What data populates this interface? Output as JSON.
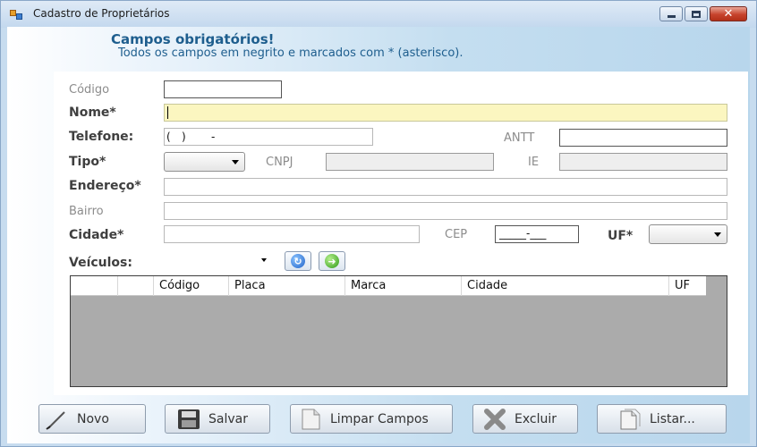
{
  "window": {
    "title": "Cadastro de Proprietários",
    "close_glyph": "✕"
  },
  "header": {
    "title": "Campos obrigatórios!",
    "subtitle": "Todos os campos em negrito e marcados com * (asterisco)."
  },
  "form": {
    "codigo": {
      "label": "Código",
      "value": ""
    },
    "nome": {
      "label": "Nome*",
      "value": ""
    },
    "telefone": {
      "label": "Telefone:",
      "mask_open": "(",
      "mask_close": ")",
      "mask_dash": "-"
    },
    "antt": {
      "label": "ANTT",
      "value": ""
    },
    "tipo": {
      "label": "Tipo*",
      "selected": ""
    },
    "cnpj": {
      "label": "CNPJ",
      "value": ""
    },
    "ie": {
      "label": "IE",
      "value": ""
    },
    "endereco": {
      "label": "Endereço*",
      "value": ""
    },
    "bairro": {
      "label": "Bairro",
      "value": ""
    },
    "cidade": {
      "label": "Cidade*",
      "value": ""
    },
    "cep": {
      "label": "CEP",
      "mask": "_____-___"
    },
    "uf": {
      "label": "UF*",
      "selected": ""
    },
    "veiculos": {
      "label": "Veículos:"
    }
  },
  "grid": {
    "columns": [
      "",
      "Código",
      "Placa",
      "Marca",
      "Cidade",
      "UF"
    ],
    "rows": []
  },
  "icons": {
    "refresh": "refresh-icon",
    "add": "add-icon"
  },
  "buttons": {
    "novo": "Novo",
    "salvar": "Salvar",
    "limpar": "Limpar Campos",
    "excluir": "Excluir",
    "listar": "Listar..."
  },
  "colors": {
    "header_text": "#1e5e8e",
    "active_field": "#fbf6c0",
    "grid_bg": "#ababab"
  }
}
